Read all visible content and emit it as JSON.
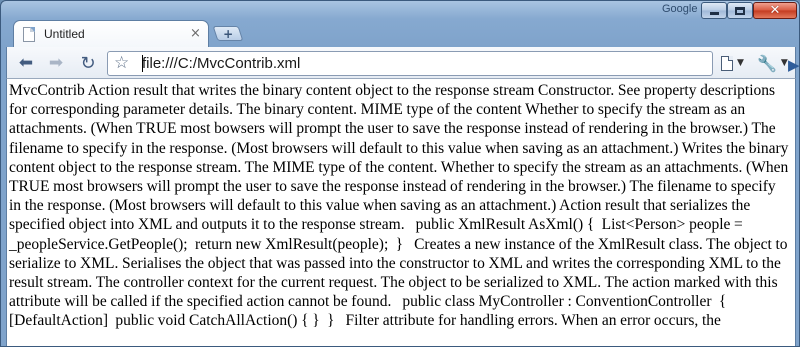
{
  "window": {
    "brand": "Google",
    "controls": {
      "minimize": "minimize-icon",
      "maximize": "maximize-icon",
      "close": "close-icon"
    },
    "colors": {
      "frame": "#86a9d0",
      "close": "#c33a20"
    }
  },
  "tabs": [
    {
      "title": "Untitled",
      "active": true
    }
  ],
  "toolbar": {
    "back_icon": "back-arrow-icon",
    "forward_icon": "forward-arrow-icon",
    "reload_icon": "reload-icon",
    "url": "file:///C:/MvcContrib.xml"
  },
  "content": {
    "text": "MvcContrib Action result that writes the binary content object to the response stream Constructor. See property descriptions for corresponding parameter details. The binary content. MIME type of the content Whether to specify the stream as an attachments. (When TRUE most bowsers will prompt the user to save the response instead of rendering in the browser.) The filename to specify in the response. (Most browsers will default to this value when saving as an attachment.) Writes the binary content object to the response stream. The MIME type of the content. Whether to specify the stream as an attachments. (When TRUE most browsers will prompt the user to save the response instead of rendering in the browser.) The filename to specify in the response. (Most browsers will default to this value when saving as an attachment.) Action result that serializes the specified object into XML and outputs it to the response stream.   public XmlResult AsXml() {  List<Person> people = _peopleService.GetPeople();  return new XmlResult(people);  }   Creates a new instance of the XmlResult class. The object to serialize to XML. Serialises the object that was passed into the constructor to XML and writes the corresponding XML to the result stream. The controller context for the current request. The object to be serialized to XML. The action marked with this attribute will be called if the specified action cannot be found.   public class MyController : ConventionController  {  [DefaultAction]  public void CatchAllAction() { }  }   Filter attribute for handling errors. When an error occurs, the"
  }
}
